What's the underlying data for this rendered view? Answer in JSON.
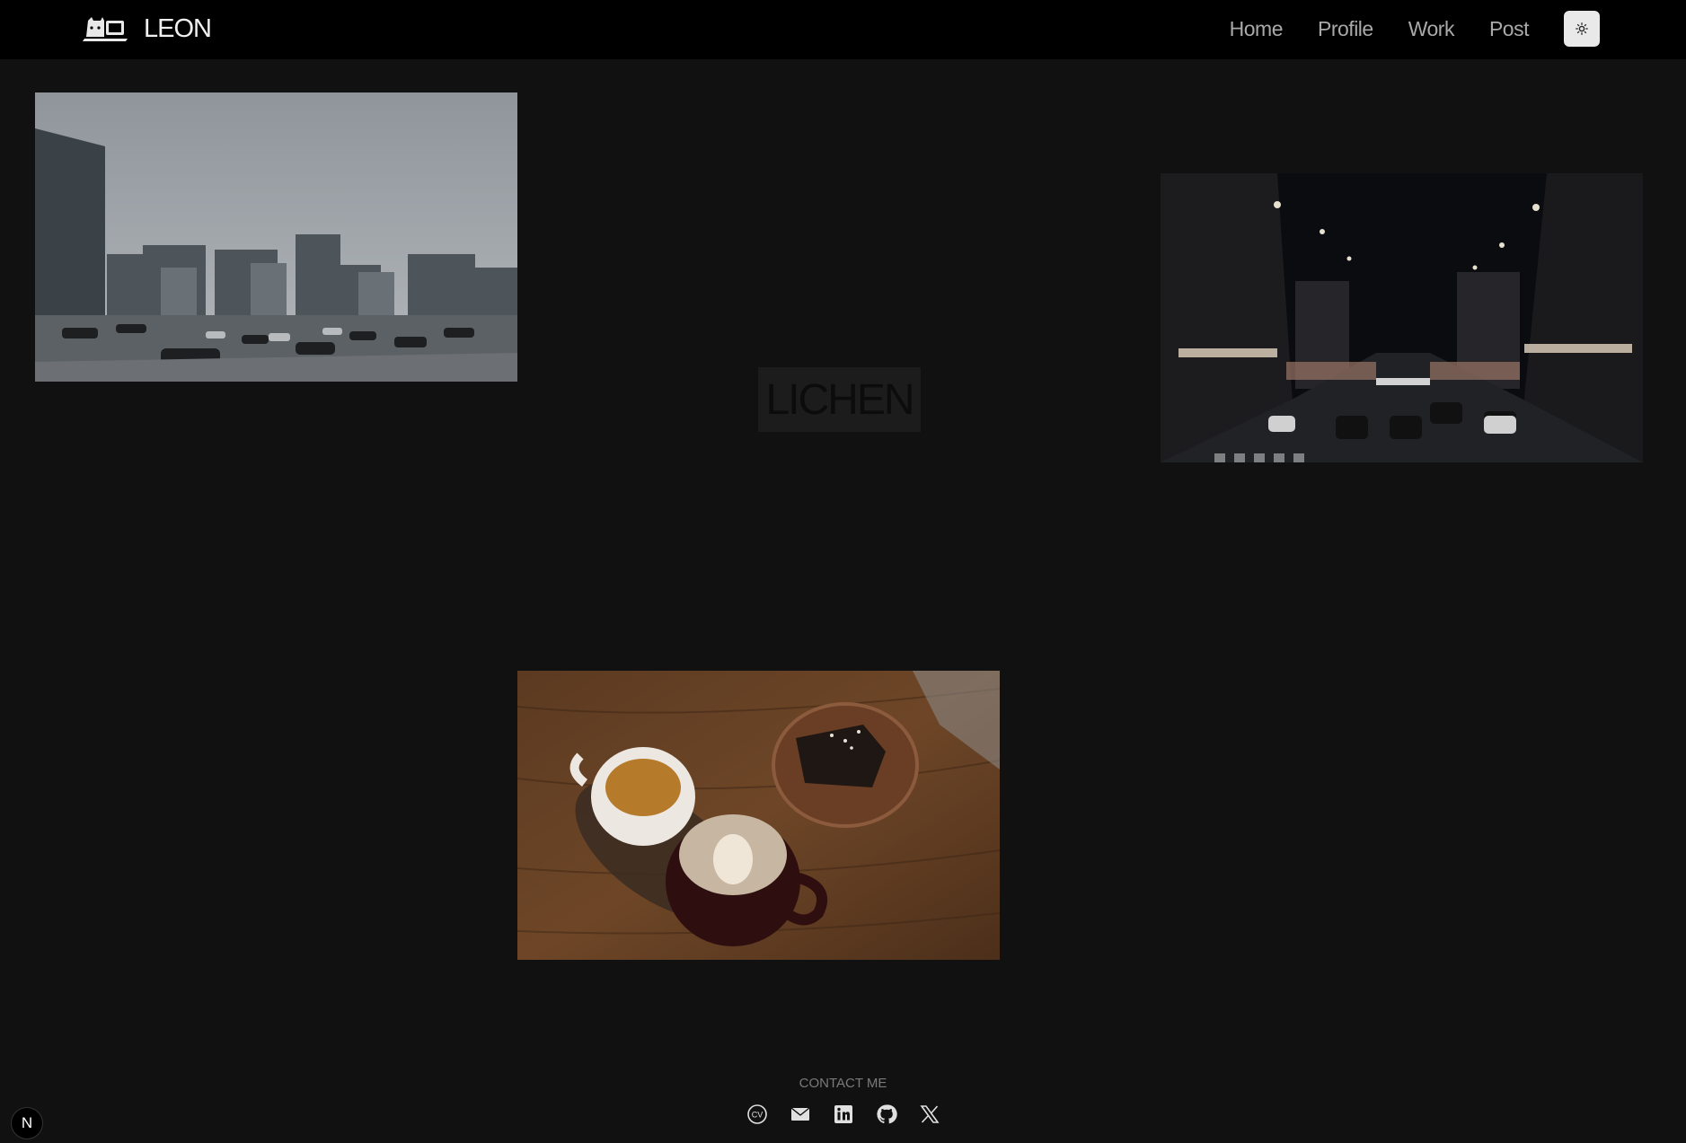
{
  "header": {
    "brand_name": "LEON",
    "logo_icon": "laptop-cat-icon",
    "nav": [
      {
        "label": "Home"
      },
      {
        "label": "Profile"
      },
      {
        "label": "Work"
      },
      {
        "label": "Post"
      }
    ],
    "theme_toggle_icon": "sun-icon"
  },
  "main": {
    "center_title": "LICHEN",
    "photos": [
      {
        "subject": "city-street-daytime"
      },
      {
        "subject": "city-street-night"
      },
      {
        "subject": "coffee-and-brownie"
      }
    ]
  },
  "footer": {
    "contact_label": "CONTACT ME",
    "icons": [
      "cv-icon",
      "mail-icon",
      "linkedin-icon",
      "github-icon",
      "x-icon"
    ]
  },
  "corner_badge": {
    "label": "N"
  },
  "colors": {
    "background": "#111111",
    "header": "#000000",
    "nav_text": "#a9a9a9",
    "brand_text": "#f0f0f0"
  }
}
